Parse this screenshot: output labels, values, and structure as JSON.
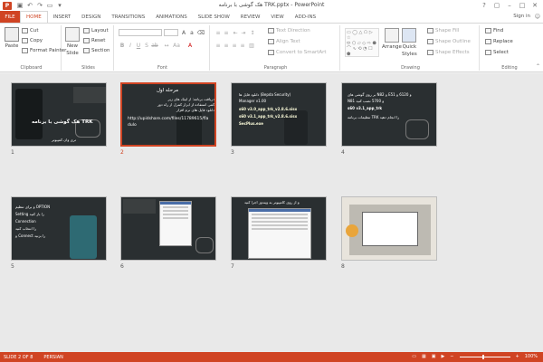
{
  "window": {
    "title": "هک گوشی با برنامه TRK.pptx - PowerPoint",
    "app_logo": "P",
    "controls": [
      "?",
      "▢",
      "–",
      "□",
      "✕"
    ]
  },
  "tabs": {
    "file": "FILE",
    "items": [
      "HOME",
      "INSERT",
      "DESIGN",
      "TRANSITIONS",
      "ANIMATIONS",
      "SLIDE SHOW",
      "REVIEW",
      "VIEW",
      "ADD-INS"
    ],
    "active": "HOME",
    "signin": "Sign in"
  },
  "ribbon": {
    "clipboard": {
      "label": "Clipboard",
      "paste": "Paste",
      "cut": "Cut",
      "copy": "Copy",
      "format_painter": "Format Painter"
    },
    "slides": {
      "label": "Slides",
      "new_slide": "New",
      "new_slide2": "Slide",
      "layout": "Layout",
      "reset": "Reset",
      "section": "Section"
    },
    "font": {
      "label": "Font"
    },
    "paragraph": {
      "label": "Paragraph",
      "text_direction": "Text Direction",
      "align_text": "Align Text",
      "convert": "Convert to SmartArt"
    },
    "drawing": {
      "label": "Drawing",
      "arrange": "Arrange",
      "quick_styles": "Quick",
      "quick_styles2": "Styles",
      "shape_fill": "Shape Fill",
      "shape_outline": "Shape Outline",
      "shape_effects": "Shape Effects"
    },
    "editing": {
      "label": "Editing",
      "find": "Find",
      "replace": "Replace",
      "select": "Select"
    }
  },
  "slides": [
    {
      "number": "1",
      "title": "هک گوشی با برنامه TRK",
      "subtitle": "تری وان کمپیوتر",
      "selected": false
    },
    {
      "number": "2",
      "title": "مرحله اول",
      "lines": [
        "دریافت برنامه: از لینک های زیر",
        "کمی استفاده از ابزار کنترل از راه دور",
        "دانلود فایل های نرم افزار",
        "http://upidshare.com/files/11789615/fla",
        "dulo"
      ],
      "selected": true
    },
    {
      "number": "3",
      "lines": [
        "دانلود فایل ها (Bepda Security)",
        "Manager v1.00",
        "s60 v3.0_app_trk_v2.8.6.sisx",
        "s60 v3.1_app_trk_v2.8.6.sisx",
        "SecPlus.exe"
      ],
      "selected": false
    },
    {
      "number": "4",
      "lines": [
        "بر روی گوشی های N82 و E51 و 6120 و",
        "N81 و 5700 نصب کنید",
        "s60 v3.1_app_trk",
        "تنظیمات برنامه TRK را انجام دهید"
      ],
      "selected": false
    },
    {
      "number": "5",
      "lines": [
        "و برای تنظیم OPTION",
        "Setting را باز کنید",
        "Connection",
        "را انتخاب کنید",
        "و Connect را بزنید"
      ],
      "selected": false
    },
    {
      "number": "6",
      "lines": [],
      "selected": false
    },
    {
      "number": "7",
      "lines": [
        "و از روی کامپیوتر به ویندوز اجرا کنید"
      ],
      "selected": false
    },
    {
      "number": "8",
      "lines": [],
      "selected": false
    }
  ],
  "status": {
    "slide_info": "SLIDE 2 OF 8",
    "language": "PERSIAN",
    "zoom": "100%",
    "zoom_fraction": 0.45
  }
}
